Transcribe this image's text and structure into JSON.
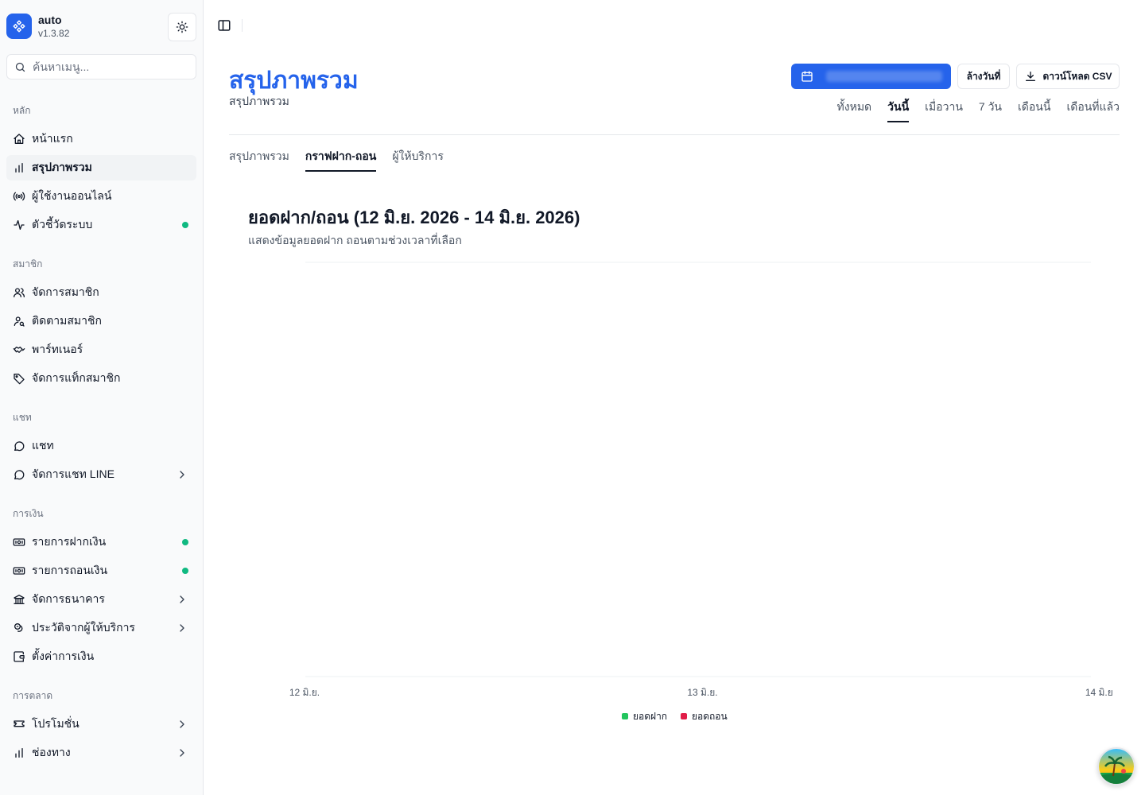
{
  "app": {
    "name": "auto",
    "version": "v1.3.82"
  },
  "search": {
    "placeholder": "ค้นหาเมนู..."
  },
  "sidebar": {
    "groups": [
      {
        "label": "หลัก",
        "items": [
          {
            "label": "หน้าแรก",
            "icon": "home-icon"
          },
          {
            "label": "สรุปภาพรวม",
            "icon": "bar-chart-icon",
            "active": true
          },
          {
            "label": "ผู้ใช้งานออนไลน์",
            "icon": "broadcast-icon"
          },
          {
            "label": "ตัวชี้วัดระบบ",
            "icon": "activity-icon",
            "status_dot": "#10b981"
          }
        ]
      },
      {
        "label": "สมาชิก",
        "items": [
          {
            "label": "จัดการสมาชิก",
            "icon": "users-icon"
          },
          {
            "label": "ติดตามสมาชิก",
            "icon": "user-search-icon"
          },
          {
            "label": "พาร์ทเนอร์",
            "icon": "handshake-icon"
          },
          {
            "label": "จัดการแท็กสมาชิก",
            "icon": "tag-icon"
          }
        ]
      },
      {
        "label": "แชท",
        "items": [
          {
            "label": "แชท",
            "icon": "chat-icon"
          },
          {
            "label": "จัดการแชท LINE",
            "icon": "chat-icon",
            "has_submenu": true
          }
        ]
      },
      {
        "label": "การเงิน",
        "items": [
          {
            "label": "รายการฝากเงิน",
            "icon": "deposit-icon",
            "status_dot": "#10b981"
          },
          {
            "label": "รายการถอนเงิน",
            "icon": "withdraw-icon",
            "status_dot": "#10b981"
          },
          {
            "label": "จัดการธนาคาร",
            "icon": "bank-icon",
            "has_submenu": true
          },
          {
            "label": "ประวัติจากผู้ให้บริการ",
            "icon": "coins-icon",
            "has_submenu": true
          },
          {
            "label": "ตั้งค่าการเงิน",
            "icon": "wallet-icon"
          }
        ]
      },
      {
        "label": "การตลาด",
        "items": [
          {
            "label": "โปรโมชั่น",
            "icon": "ticket-icon",
            "has_submenu": true
          },
          {
            "label": "ช่องทาง",
            "icon": "bar-chart-icon",
            "has_submenu": true
          }
        ]
      }
    ]
  },
  "header": {
    "title": "สรุปภาพรวม",
    "subtitle": "สรุปภาพรวม",
    "clear_date_label": "ล้างวันที่",
    "download_csv_label": "ดาวน์โหลด CSV",
    "range_tabs": [
      "ทั้งหมด",
      "วันนี้",
      "เมื่อวาน",
      "7 วัน",
      "เดือนนี้",
      "เดือนที่แล้ว"
    ],
    "active_range": "วันนี้"
  },
  "tabs": {
    "items": [
      "สรุปภาพรวม",
      "กราฟฝาก-ถอน",
      "ผู้ให้บริการ"
    ],
    "active": "กราฟฝาก-ถอน"
  },
  "chart": {
    "title": "ยอดฝาก/ถอน (12 มิ.ย. 2026 - 14 มิ.ย. 2026)",
    "description": "แสดงข้อมูลยอดฝาก ถอนตามช่วงเวลาที่เลือก"
  },
  "chart_data": {
    "type": "line",
    "x": [
      "12 มิ.ย.",
      "13 มิ.ย.",
      "14 มิ.ย."
    ],
    "series": [
      {
        "name": "ยอดฝาก",
        "color": "#22c55e",
        "values": []
      },
      {
        "name": "ยอดถอน",
        "color": "#e11d48",
        "values": []
      }
    ],
    "grid": true,
    "legend_position": "bottom-center"
  },
  "colors": {
    "accent": "#2563eb",
    "status_online": "#10b981"
  }
}
